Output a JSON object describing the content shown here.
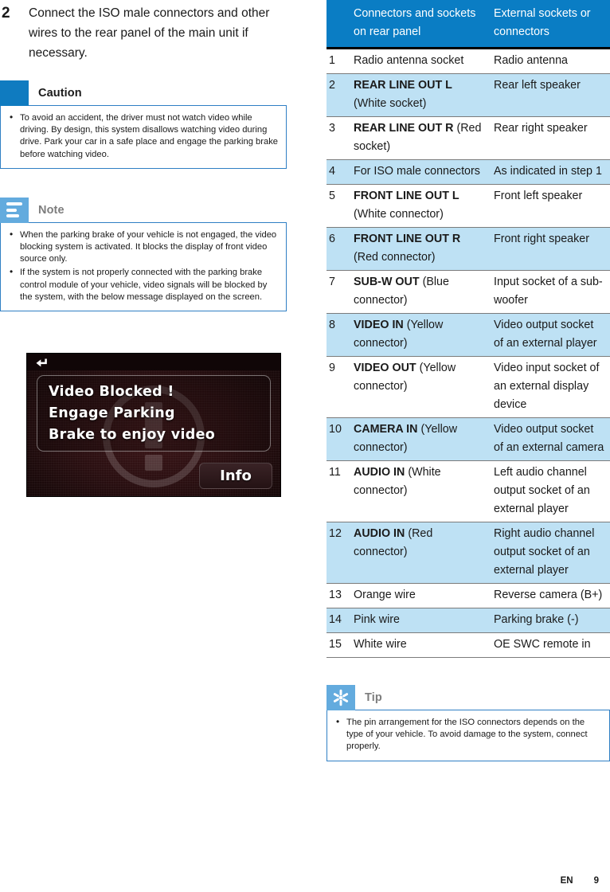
{
  "step": {
    "number": "2",
    "text": "Connect the ISO male connectors and other wires to the rear panel of the main unit if necessary."
  },
  "caution": {
    "icon": "exclamation-icon",
    "title": "Caution",
    "items": [
      "To avoid an accident, the driver must not watch video while driving. By design, this system disallows watching video during drive. Park your car in a safe place and engage the parking brake before watching video."
    ],
    "icon_bg": "#0F7BC0"
  },
  "note": {
    "icon": "note-lines-icon",
    "title": "Note",
    "items": [
      "When the parking brake of your vehicle is not engaged, the video blocking system is activated. It blocks the display of front video source only.",
      "If the system is not properly connected with the parking brake control module of your vehicle, video signals will be blocked by the system, with the below message displayed on the screen."
    ],
    "icon_bg": "#63ABDE"
  },
  "tip": {
    "icon": "asterisk-icon",
    "title": "Tip",
    "items": [
      "The pin arrangement for the ISO connectors depends on the type of your vehicle. To avoid damage to the system, connect properly."
    ],
    "icon_bg": "#63ABDE"
  },
  "screenshot": {
    "back_icon": "back-arrow-icon",
    "warning_icon": "warning-exclamation-icon",
    "message_line1": "Video Blocked !",
    "message_line2": "Engage Parking",
    "message_line3": "Brake to enjoy video",
    "info_button": "Info"
  },
  "table": {
    "headers": {
      "num": "",
      "desc": "Connectors and sockets on rear panel",
      "ext": "External sockets or connectors"
    },
    "header_bg": "#0A7DC4",
    "shade_bg": "#BEE1F4",
    "rows": [
      {
        "num": "1",
        "desc_bold": "",
        "desc_rest": "Radio antenna socket",
        "ext": "Radio antenna",
        "shaded": false
      },
      {
        "num": "2",
        "desc_bold": "REAR LINE OUT L",
        "desc_rest": " (White socket)",
        "ext": "Rear left speaker",
        "shaded": true
      },
      {
        "num": "3",
        "desc_bold": "REAR LINE OUT R",
        "desc_rest": " (Red socket)",
        "ext": "Rear right speaker",
        "shaded": false
      },
      {
        "num": "4",
        "desc_bold": "",
        "desc_rest": "For ISO male connectors",
        "ext": "As indicated in step 1",
        "shaded": true
      },
      {
        "num": "5",
        "desc_bold": "FRONT LINE OUT L",
        "desc_rest": " (White connector)",
        "ext": "Front left speaker",
        "shaded": false
      },
      {
        "num": "6",
        "desc_bold": "FRONT LINE OUT R",
        "desc_rest": " (Red connector)",
        "ext": "Front right speaker",
        "shaded": true
      },
      {
        "num": "7",
        "desc_bold": "SUB-W OUT",
        "desc_rest": " (Blue connector)",
        "ext": "Input socket of a sub-woofer",
        "shaded": false
      },
      {
        "num": "8",
        "desc_bold": "VIDEO IN",
        "desc_rest": " (Yellow connector)",
        "ext": "Video output socket of an external player",
        "shaded": true
      },
      {
        "num": "9",
        "desc_bold": "VIDEO OUT",
        "desc_rest": " (Yellow connector)",
        "ext": "Video input socket of an external display device",
        "shaded": false
      },
      {
        "num": "10",
        "desc_bold": "CAMERA IN",
        "desc_rest": " (Yellow connector)",
        "ext": "Video output socket of an external camera",
        "shaded": true
      },
      {
        "num": "11",
        "desc_bold": "AUDIO IN",
        "desc_rest": " (White connector)",
        "ext": "Left audio channel output socket of an external player",
        "shaded": false
      },
      {
        "num": "12",
        "desc_bold": "AUDIO IN",
        "desc_rest": " (Red connector)",
        "ext": "Right audio channel output socket of an external player",
        "shaded": true
      },
      {
        "num": "13",
        "desc_bold": "",
        "desc_rest": "Orange wire",
        "ext": "Reverse camera (B+)",
        "shaded": false
      },
      {
        "num": "14",
        "desc_bold": "",
        "desc_rest": "Pink wire",
        "ext": "Parking brake (-)",
        "shaded": true
      },
      {
        "num": "15",
        "desc_bold": "",
        "desc_rest": "White wire",
        "ext": "OE SWC remote in",
        "shaded": false
      }
    ]
  },
  "footer": {
    "language": "EN",
    "page": "9"
  }
}
